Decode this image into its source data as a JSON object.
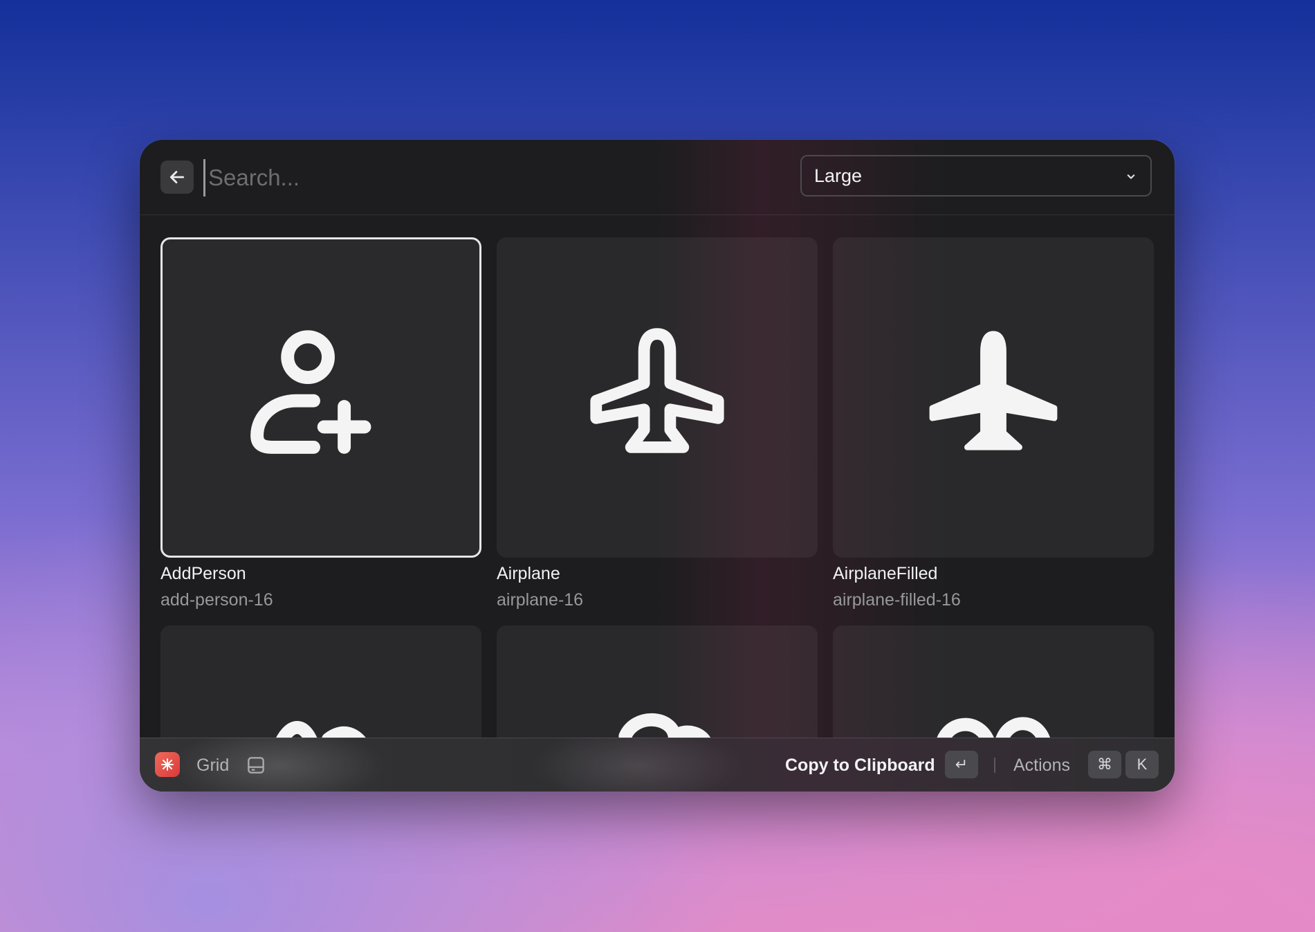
{
  "search": {
    "placeholder": "Search..."
  },
  "size_dropdown": {
    "value": "Large"
  },
  "items": [
    {
      "title": "AddPerson",
      "subtitle": "add-person-16",
      "icon": "add-person-icon"
    },
    {
      "title": "Airplane",
      "subtitle": "airplane-16",
      "icon": "airplane-icon"
    },
    {
      "title": "AirplaneFilled",
      "subtitle": "airplane-filled-16",
      "icon": "airplane-filled-icon"
    }
  ],
  "footer": {
    "view_label": "Grid",
    "primary_action": "Copy to Clipboard",
    "primary_key": "↵",
    "actions_label": "Actions",
    "actions_key_1": "⌘",
    "actions_key_2": "K"
  },
  "colors": {
    "window_bg": "#1d1d1f",
    "selected_border": "#e6e6e8",
    "app_icon": "#e85048"
  }
}
